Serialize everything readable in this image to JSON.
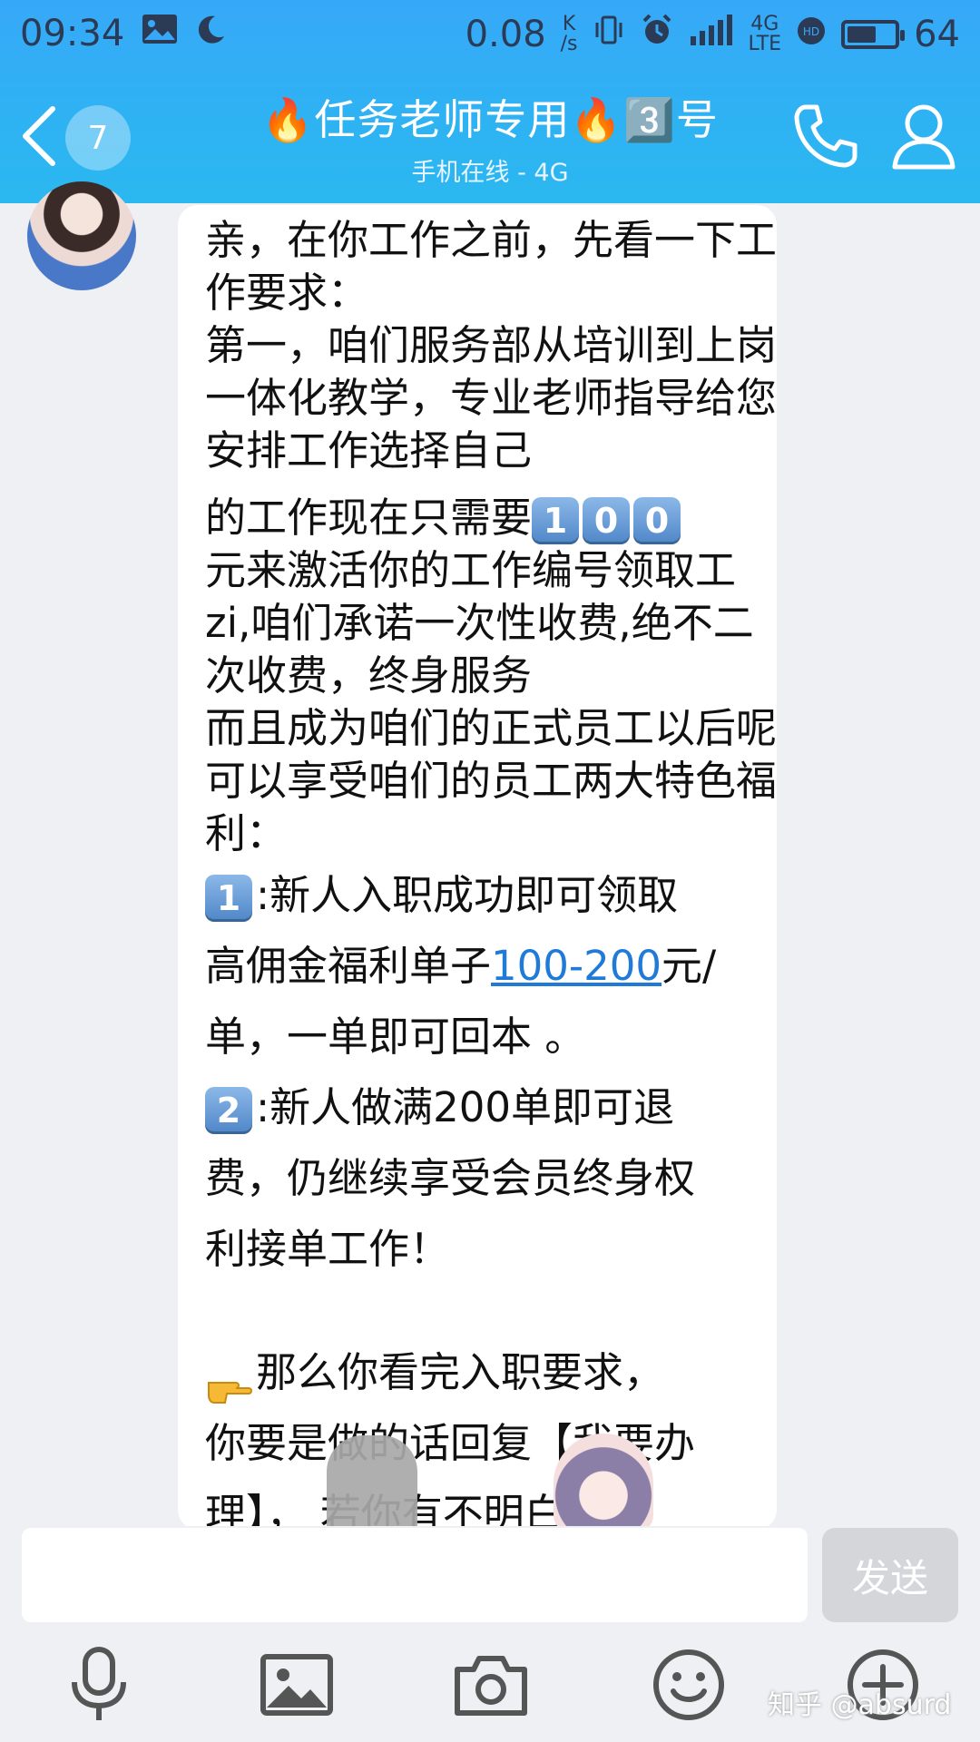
{
  "status_bar": {
    "time": "09:34",
    "speed": "0.08",
    "speed_unit_top": "K",
    "speed_unit_bottom": "/s",
    "network_top": "4G",
    "network_bottom": "LTE",
    "battery_level": "64"
  },
  "header": {
    "unread_count": "7",
    "title": "🔥任务老师专用🔥3️⃣号",
    "subtitle": "手机在线 - 4G"
  },
  "message": {
    "lines": {
      "l1": "亲，在你工作之前，先看一下工作要求：",
      "l2": "第一，咱们服务部从培训到上岗一体化教学，专业老师指导给您安排工作选择自己",
      "l3_pre": "的工作现在只需要",
      "l3_digit1": "1",
      "l3_digit2": "0",
      "l3_digit3": "0",
      "l4": "元来激活你的工作编号领取工zi,咱们承诺一次性收费,绝不二次收费，终身服务",
      "l5": "而且成为咱们的正式员工以后呢  可以享受咱们的员工两大特色福利：",
      "b1_num": "1",
      "b1_a": ":新人入职成功即可领取",
      "b1_b": "高佣金福利单子",
      "b1_link": "100-200",
      "b1_c": "元/",
      "b1_d": "单，一单即可回本 。",
      "b2_num": "2",
      "b2_a": ":新人做满200单即可退",
      "b2_b": "费，仍继续享受会员终身权",
      "b2_c": "利接单工作！",
      "p_a": "那么你看完入职要求，",
      "p_b": "你要是做的话回复【我要办",
      "p_c": "理】，   若你有不明白的都"
    }
  },
  "input": {
    "placeholder": "",
    "send_label": "发送"
  },
  "toolbar": {
    "icons": [
      "microphone-icon",
      "image-icon",
      "camera-icon",
      "emoji-icon",
      "plus-icon"
    ]
  },
  "watermark": "知乎 @absurd"
}
